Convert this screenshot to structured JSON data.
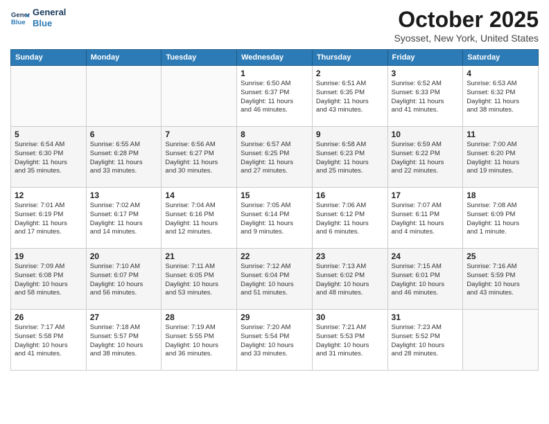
{
  "logo": {
    "line1": "General",
    "line2": "Blue"
  },
  "title": "October 2025",
  "location": "Syosset, New York, United States",
  "days_of_week": [
    "Sunday",
    "Monday",
    "Tuesday",
    "Wednesday",
    "Thursday",
    "Friday",
    "Saturday"
  ],
  "weeks": [
    [
      {
        "day": "",
        "info": ""
      },
      {
        "day": "",
        "info": ""
      },
      {
        "day": "",
        "info": ""
      },
      {
        "day": "1",
        "info": "Sunrise: 6:50 AM\nSunset: 6:37 PM\nDaylight: 11 hours\nand 46 minutes."
      },
      {
        "day": "2",
        "info": "Sunrise: 6:51 AM\nSunset: 6:35 PM\nDaylight: 11 hours\nand 43 minutes."
      },
      {
        "day": "3",
        "info": "Sunrise: 6:52 AM\nSunset: 6:33 PM\nDaylight: 11 hours\nand 41 minutes."
      },
      {
        "day": "4",
        "info": "Sunrise: 6:53 AM\nSunset: 6:32 PM\nDaylight: 11 hours\nand 38 minutes."
      }
    ],
    [
      {
        "day": "5",
        "info": "Sunrise: 6:54 AM\nSunset: 6:30 PM\nDaylight: 11 hours\nand 35 minutes."
      },
      {
        "day": "6",
        "info": "Sunrise: 6:55 AM\nSunset: 6:28 PM\nDaylight: 11 hours\nand 33 minutes."
      },
      {
        "day": "7",
        "info": "Sunrise: 6:56 AM\nSunset: 6:27 PM\nDaylight: 11 hours\nand 30 minutes."
      },
      {
        "day": "8",
        "info": "Sunrise: 6:57 AM\nSunset: 6:25 PM\nDaylight: 11 hours\nand 27 minutes."
      },
      {
        "day": "9",
        "info": "Sunrise: 6:58 AM\nSunset: 6:23 PM\nDaylight: 11 hours\nand 25 minutes."
      },
      {
        "day": "10",
        "info": "Sunrise: 6:59 AM\nSunset: 6:22 PM\nDaylight: 11 hours\nand 22 minutes."
      },
      {
        "day": "11",
        "info": "Sunrise: 7:00 AM\nSunset: 6:20 PM\nDaylight: 11 hours\nand 19 minutes."
      }
    ],
    [
      {
        "day": "12",
        "info": "Sunrise: 7:01 AM\nSunset: 6:19 PM\nDaylight: 11 hours\nand 17 minutes."
      },
      {
        "day": "13",
        "info": "Sunrise: 7:02 AM\nSunset: 6:17 PM\nDaylight: 11 hours\nand 14 minutes."
      },
      {
        "day": "14",
        "info": "Sunrise: 7:04 AM\nSunset: 6:16 PM\nDaylight: 11 hours\nand 12 minutes."
      },
      {
        "day": "15",
        "info": "Sunrise: 7:05 AM\nSunset: 6:14 PM\nDaylight: 11 hours\nand 9 minutes."
      },
      {
        "day": "16",
        "info": "Sunrise: 7:06 AM\nSunset: 6:12 PM\nDaylight: 11 hours\nand 6 minutes."
      },
      {
        "day": "17",
        "info": "Sunrise: 7:07 AM\nSunset: 6:11 PM\nDaylight: 11 hours\nand 4 minutes."
      },
      {
        "day": "18",
        "info": "Sunrise: 7:08 AM\nSunset: 6:09 PM\nDaylight: 11 hours\nand 1 minute."
      }
    ],
    [
      {
        "day": "19",
        "info": "Sunrise: 7:09 AM\nSunset: 6:08 PM\nDaylight: 10 hours\nand 58 minutes."
      },
      {
        "day": "20",
        "info": "Sunrise: 7:10 AM\nSunset: 6:07 PM\nDaylight: 10 hours\nand 56 minutes."
      },
      {
        "day": "21",
        "info": "Sunrise: 7:11 AM\nSunset: 6:05 PM\nDaylight: 10 hours\nand 53 minutes."
      },
      {
        "day": "22",
        "info": "Sunrise: 7:12 AM\nSunset: 6:04 PM\nDaylight: 10 hours\nand 51 minutes."
      },
      {
        "day": "23",
        "info": "Sunrise: 7:13 AM\nSunset: 6:02 PM\nDaylight: 10 hours\nand 48 minutes."
      },
      {
        "day": "24",
        "info": "Sunrise: 7:15 AM\nSunset: 6:01 PM\nDaylight: 10 hours\nand 46 minutes."
      },
      {
        "day": "25",
        "info": "Sunrise: 7:16 AM\nSunset: 5:59 PM\nDaylight: 10 hours\nand 43 minutes."
      }
    ],
    [
      {
        "day": "26",
        "info": "Sunrise: 7:17 AM\nSunset: 5:58 PM\nDaylight: 10 hours\nand 41 minutes."
      },
      {
        "day": "27",
        "info": "Sunrise: 7:18 AM\nSunset: 5:57 PM\nDaylight: 10 hours\nand 38 minutes."
      },
      {
        "day": "28",
        "info": "Sunrise: 7:19 AM\nSunset: 5:55 PM\nDaylight: 10 hours\nand 36 minutes."
      },
      {
        "day": "29",
        "info": "Sunrise: 7:20 AM\nSunset: 5:54 PM\nDaylight: 10 hours\nand 33 minutes."
      },
      {
        "day": "30",
        "info": "Sunrise: 7:21 AM\nSunset: 5:53 PM\nDaylight: 10 hours\nand 31 minutes."
      },
      {
        "day": "31",
        "info": "Sunrise: 7:23 AM\nSunset: 5:52 PM\nDaylight: 10 hours\nand 28 minutes."
      },
      {
        "day": "",
        "info": ""
      }
    ]
  ]
}
